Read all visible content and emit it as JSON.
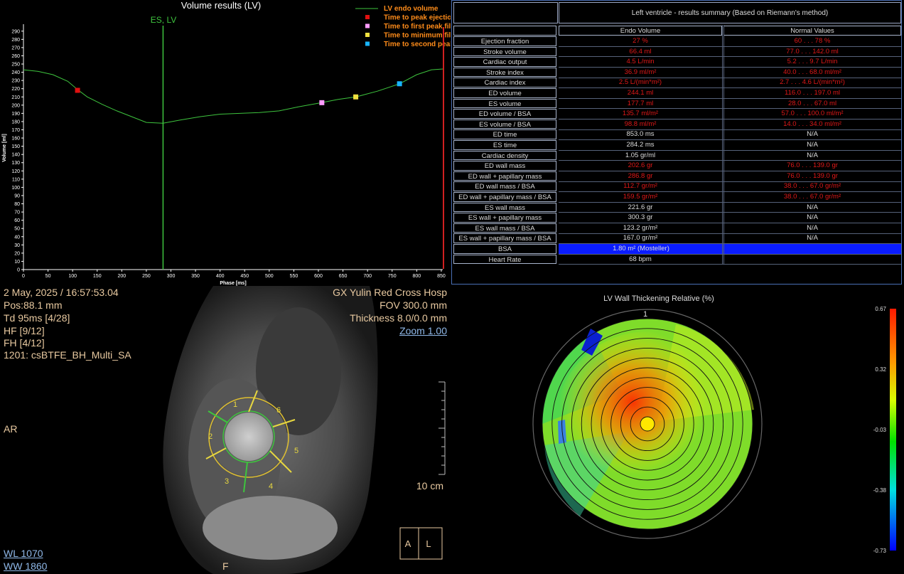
{
  "graph": {
    "title": "Volume results (LV)",
    "es_marker": "ES, LV",
    "ylabel": "Volume [ml]",
    "xlabel": "Phase [ms]",
    "legend": [
      {
        "label": "LV endo volume",
        "color": "#3ec43e",
        "kind": "line"
      },
      {
        "label": "Time to peak ejection",
        "color": "#e01010",
        "kind": "square"
      },
      {
        "label": "Time to first peak filling",
        "color": "#ff9cff",
        "kind": "square"
      },
      {
        "label": "Time to minimum filling",
        "color": "#f0e040",
        "kind": "square"
      },
      {
        "label": "Time to second peak filling",
        "color": "#18b4ff",
        "kind": "square"
      }
    ]
  },
  "chart_data": {
    "type": "line",
    "title": "Volume results (LV)",
    "xlabel": "Phase [ms]",
    "ylabel": "Volume [ml]",
    "xlim": [
      0,
      853
    ],
    "ylim": [
      0,
      295
    ],
    "x_ticks": [
      0,
      50,
      100,
      150,
      200,
      250,
      300,
      350,
      400,
      450,
      500,
      550,
      600,
      650,
      700,
      750,
      800,
      850
    ],
    "y_ticks": [
      0,
      10,
      20,
      30,
      40,
      50,
      60,
      70,
      80,
      90,
      100,
      110,
      120,
      130,
      140,
      150,
      160,
      170,
      180,
      190,
      200,
      210,
      220,
      230,
      240,
      250,
      260,
      270,
      280,
      290
    ],
    "es_time": 284,
    "series": [
      {
        "name": "LV endo volume",
        "x": [
          0,
          30,
          60,
          90,
          110,
          130,
          160,
          190,
          220,
          250,
          284,
          320,
          360,
          400,
          440,
          480,
          520,
          560,
          607,
          640,
          676,
          720,
          765,
          800,
          830,
          853
        ],
        "y": [
          243,
          241,
          237,
          229,
          219,
          210,
          201,
          193,
          186,
          179,
          178,
          182,
          186,
          189,
          190,
          191,
          193,
          198,
          203,
          207,
          210,
          217,
          226,
          237,
          243,
          244
        ]
      }
    ],
    "markers": [
      {
        "name": "Time to peak ejection",
        "x": 110,
        "y": 218,
        "color": "#e01010"
      },
      {
        "name": "Time to first peak filling",
        "x": 607,
        "y": 203,
        "color": "#ff9cff"
      },
      {
        "name": "Time to minimum filling",
        "x": 676,
        "y": 210,
        "color": "#f0e040"
      },
      {
        "name": "Time to second peak filling",
        "x": 765,
        "y": 226,
        "color": "#18b4ff"
      }
    ]
  },
  "results": {
    "title": "Left ventricle - results summary (Based on Riemann's method)",
    "col_endo": "Endo Volume",
    "col_normal": "Normal Values",
    "rows": [
      {
        "label": "Ejection fraction",
        "endo": "27  %",
        "normal": "60 . . . 78  %",
        "abnormal": true
      },
      {
        "label": "Stroke volume",
        "endo": "66.4  ml",
        "normal": "77.0 . . . 142.0  ml",
        "abnormal": true
      },
      {
        "label": "Cardiac output",
        "endo": "4.5  L/min",
        "normal": "5.2 . . . 9.7  L/min",
        "abnormal": true
      },
      {
        "label": "Stroke index",
        "endo": "36.9  ml/m²",
        "normal": "40.0 . . . 68.0  ml/m²",
        "abnormal": true
      },
      {
        "label": "Cardiac index",
        "endo": "2.5  L/(min*m²)",
        "normal": "2.7 . . . 4.6  L/(min*m²)",
        "abnormal": true
      },
      {
        "label": "ED volume",
        "endo": "244.1  ml",
        "normal": "116.0 . . . 197.0  ml",
        "abnormal": true
      },
      {
        "label": "ES volume",
        "endo": "177.7  ml",
        "normal": "28.0 . . . 67.0  ml",
        "abnormal": true
      },
      {
        "label": "ED volume / BSA",
        "endo": "135.7  ml/m²",
        "normal": "57.0 . . . 100.0  ml/m²",
        "abnormal": true
      },
      {
        "label": "ES volume / BSA",
        "endo": "98.8  ml/m²",
        "normal": "14.0 . . . 34.0  ml/m²",
        "abnormal": true
      },
      {
        "label": "ED time",
        "endo": "853.0  ms",
        "normal": "N/A",
        "abnormal": false
      },
      {
        "label": "ES time",
        "endo": "284.2  ms",
        "normal": "N/A",
        "abnormal": false
      },
      {
        "label": "Cardiac density",
        "endo": "1.05  gr/ml",
        "normal": "N/A",
        "abnormal": false
      },
      {
        "label": "ED wall mass",
        "endo": "202.6  gr",
        "normal": "76.0 . . . 139.0  gr",
        "abnormal": true
      },
      {
        "label": "ED wall + papillary mass",
        "endo": "286.8  gr",
        "normal": "76.0 . . . 139.0  gr",
        "abnormal": true
      },
      {
        "label": "ED wall mass / BSA",
        "endo": "112.7  gr/m²",
        "normal": "38.0 . . . 67.0  gr/m²",
        "abnormal": true
      },
      {
        "label": "ED wall + papillary mass / BSA",
        "endo": "159.5  gr/m²",
        "normal": "38.0 . . . 67.0  gr/m²",
        "abnormal": true
      },
      {
        "label": "ES wall mass",
        "endo": "221.6  gr",
        "normal": "N/A",
        "abnormal": false
      },
      {
        "label": "ES wall + papillary mass",
        "endo": "300.3  gr",
        "normal": "N/A",
        "abnormal": false
      },
      {
        "label": "ES wall mass / BSA",
        "endo": "123.2  gr/m²",
        "normal": "N/A",
        "abnormal": false
      },
      {
        "label": "ES wall + papillary mass / BSA",
        "endo": "167.0  gr/m²",
        "normal": "N/A",
        "abnormal": false
      },
      {
        "label": "BSA",
        "endo": "1.80  m²  (Mosteller)",
        "normal": "",
        "abnormal": false,
        "highlight": true
      },
      {
        "label": "Heart Rate",
        "endo": "68  bpm",
        "normal": "",
        "abnormal": false
      }
    ],
    "highlight_color": "#0a1cff"
  },
  "mri": {
    "datetime": "2 May, 2025 / 16:57:53.04",
    "pos": "Pos:88.1 mm",
    "td": "Td 95ms [4/28]",
    "hf": "HF [9/12]",
    "fh": "FH [4/12]",
    "series": "1201: csBTFE_BH_Multi_SA",
    "orientation": "AR",
    "hospital": "GX Yulin Red Cross Hosp",
    "fov": "FOV 300.0 mm",
    "thickness": "Thickness 8.0/0.0 mm",
    "zoom": "Zoom 1.00",
    "scale": "10 cm",
    "wl": "WL  1070",
    "ww": "WW  1860",
    "bottom_marker": "F",
    "orient_a": "A",
    "orient_l": "L",
    "segments": [
      "1",
      "2",
      "3",
      "4",
      "5",
      "6"
    ]
  },
  "bullseye": {
    "title": "LV Wall Thickening Relative (%)",
    "top_label": "1",
    "colorbar_labels": [
      "0.67",
      "0.32",
      "-0.03",
      "-0.38",
      "-0.73"
    ],
    "colorbar_values": [
      0.67,
      0.32,
      -0.03,
      -0.38,
      -0.73
    ]
  }
}
